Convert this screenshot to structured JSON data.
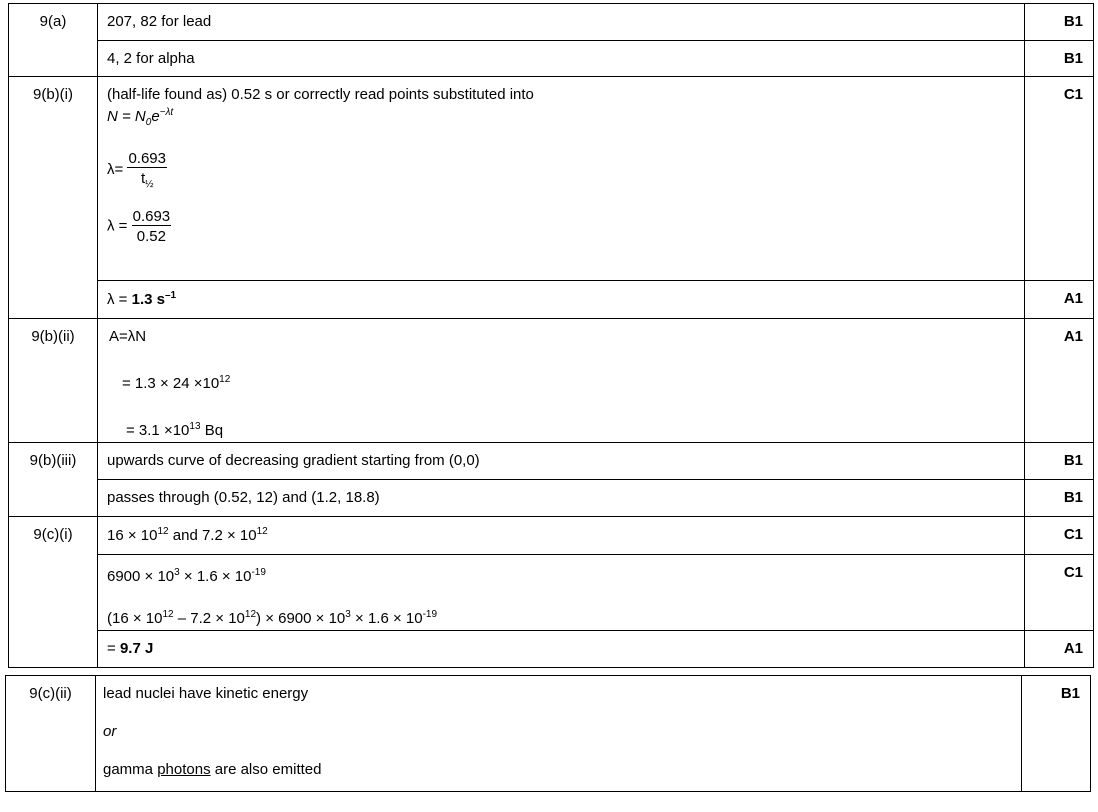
{
  "q9a": {
    "label": "9(a)",
    "a1": "207, 82 for lead",
    "m1": "B1",
    "a2": "4, 2 for alpha",
    "m2": "B1"
  },
  "q9bi": {
    "label": "9(b)(i)",
    "line1": "(half-life found as) 0.52 s or correctly read points substituted into",
    "eq_n": "N = N",
    "eq_sub0": "0",
    "eq_e": "e",
    "eq_exp": "−λt",
    "lambda_sym": "λ=",
    "frac1_num": "0.693",
    "frac1_den": "t",
    "frac1_den_sub": "½",
    "lambda_sym2": "λ =",
    "frac2_num": "0.693",
    "frac2_den": "0.52",
    "m1": "C1",
    "final_prefix": "λ = ",
    "final_val": "1.3 s",
    "final_exp": "–1",
    "m2": "A1"
  },
  "q9bii": {
    "label": "9(b)(ii)",
    "l1": "A=λN",
    "l2_pre": "= 1.3 × 24 ×10",
    "l2_exp": "12",
    "l3_pre": "= 3.1 ×10",
    "l3_exp": "13",
    "l3_post": " Bq",
    "m1": "A1"
  },
  "q9biii": {
    "label": "9(b)(iii)",
    "a1": "upwards curve of decreasing gradient starting from (0,0)",
    "m1": "B1",
    "a2": "passes through (0.52, 12) and (1.2, 18.8)",
    "m2": "B1"
  },
  "q9ci": {
    "label": "9(c)(i)",
    "a1_p1": "16 × 10",
    "a1_e1": "12",
    "a1_p2": " and 7.2 × 10",
    "a1_e2": "12",
    "m1": "C1",
    "a2_p1": "6900 × 10",
    "a2_e1": "3",
    "a2_p2": " × 1.6 × 10",
    "a2_e2": "-19",
    "m2": "C1",
    "a3_p1": "(16 × 10",
    "a3_e1": "12",
    "a3_p2": " – 7.2 × 10",
    "a3_e2": "12",
    "a3_p3": ") × 6900 × 10",
    "a3_e3": "3",
    "a3_p4": " × 1.6 × 10",
    "a3_e4": "-19",
    "a4_pre": "= ",
    "a4_val": "9.7 J",
    "m3": "A1"
  },
  "q9cii": {
    "label": "9(c)(ii)",
    "l1": "lead nuclei have kinetic energy",
    "l2": "or",
    "l3_pre": "gamma ",
    "l3_ul": "photons",
    "l3_post": " are also emitted",
    "m1": "B1"
  }
}
